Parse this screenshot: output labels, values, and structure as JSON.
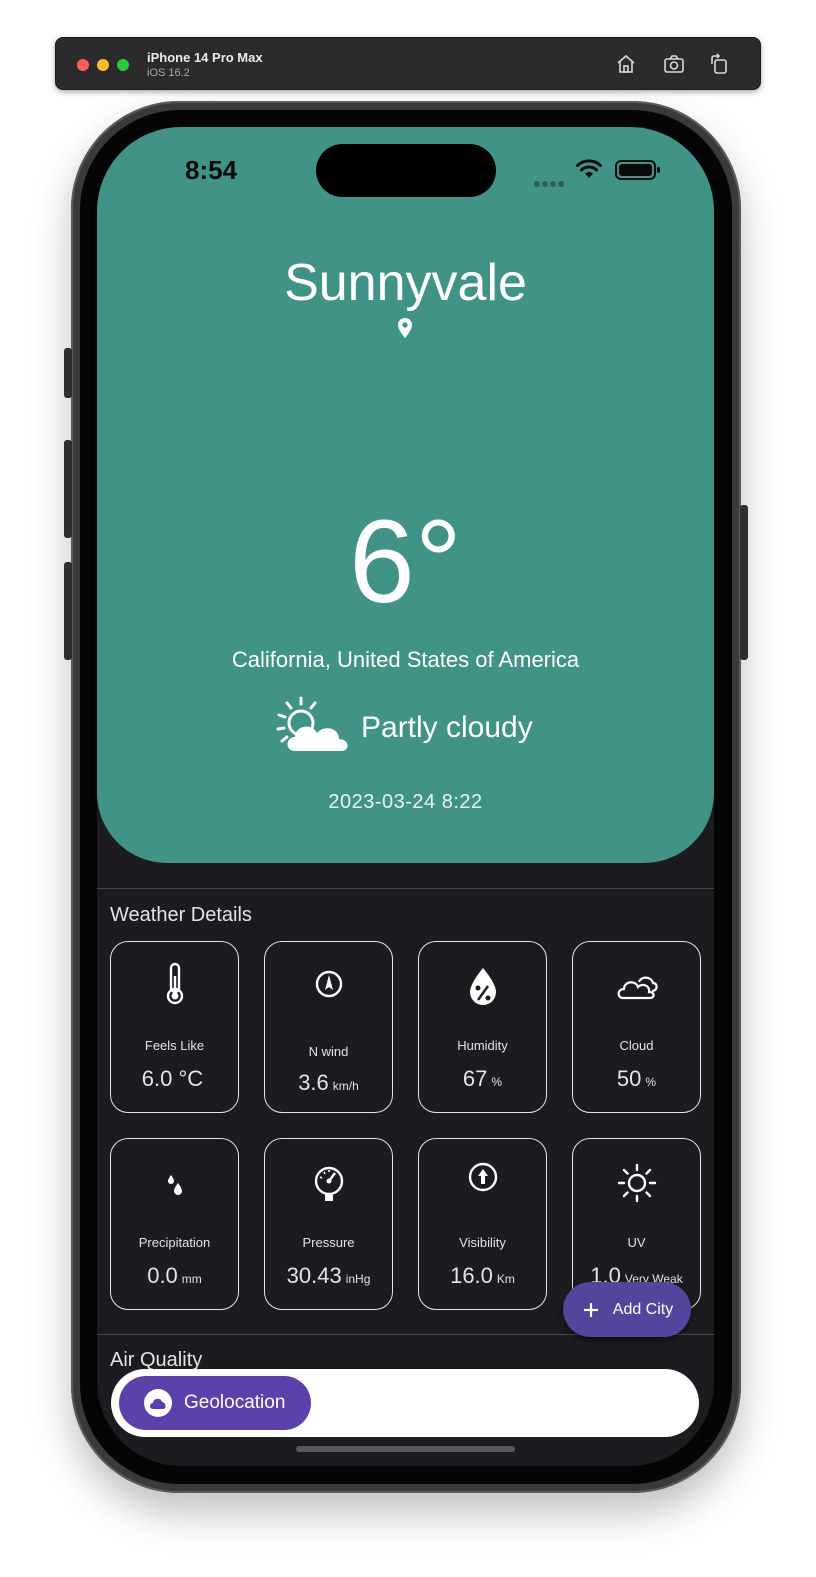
{
  "simulator": {
    "device": "iPhone 14 Pro Max",
    "os": "iOS 16.2",
    "buttons": [
      "home-icon",
      "screenshot-icon",
      "rotate-icon"
    ]
  },
  "status_bar": {
    "time": "8:54"
  },
  "hero": {
    "city": "Sunnyvale",
    "temperature": "6°",
    "region": "California, United States of America",
    "condition": "Partly cloudy",
    "datetime": "2023-03-24 8:22",
    "color": "#429387"
  },
  "weather_details": {
    "title": "Weather Details",
    "tiles": [
      {
        "icon": "thermometer-icon",
        "label": "Feels Like",
        "value": "6.0 °C",
        "unit": ""
      },
      {
        "icon": "compass-icon",
        "label": "N wind",
        "value": "3.6",
        "unit": "km/h"
      },
      {
        "icon": "humidity-icon",
        "label": "Humidity",
        "value": "67",
        "unit": "%"
      },
      {
        "icon": "cloud-icon",
        "label": "Cloud",
        "value": "50",
        "unit": "%"
      },
      {
        "icon": "precipitation-icon",
        "label": "Precipitation",
        "value": "0.0",
        "unit": "mm"
      },
      {
        "icon": "pressure-icon",
        "label": "Pressure",
        "value": "30.43",
        "unit": "inHg"
      },
      {
        "icon": "visibility-icon",
        "label": "Visibility",
        "value": "16.0",
        "unit": "Km"
      },
      {
        "icon": "sun-icon",
        "label": "UV",
        "value": "1.0",
        "unit": "Very Weak"
      }
    ]
  },
  "air_quality": {
    "title": "Air Quality"
  },
  "fab": {
    "label": "Add City",
    "icon": "plus-icon",
    "color": "#53449c"
  },
  "bottom_nav": {
    "geolocation_label": "Geolocation",
    "icon": "cloud-icon",
    "color": "#5c41ab"
  }
}
